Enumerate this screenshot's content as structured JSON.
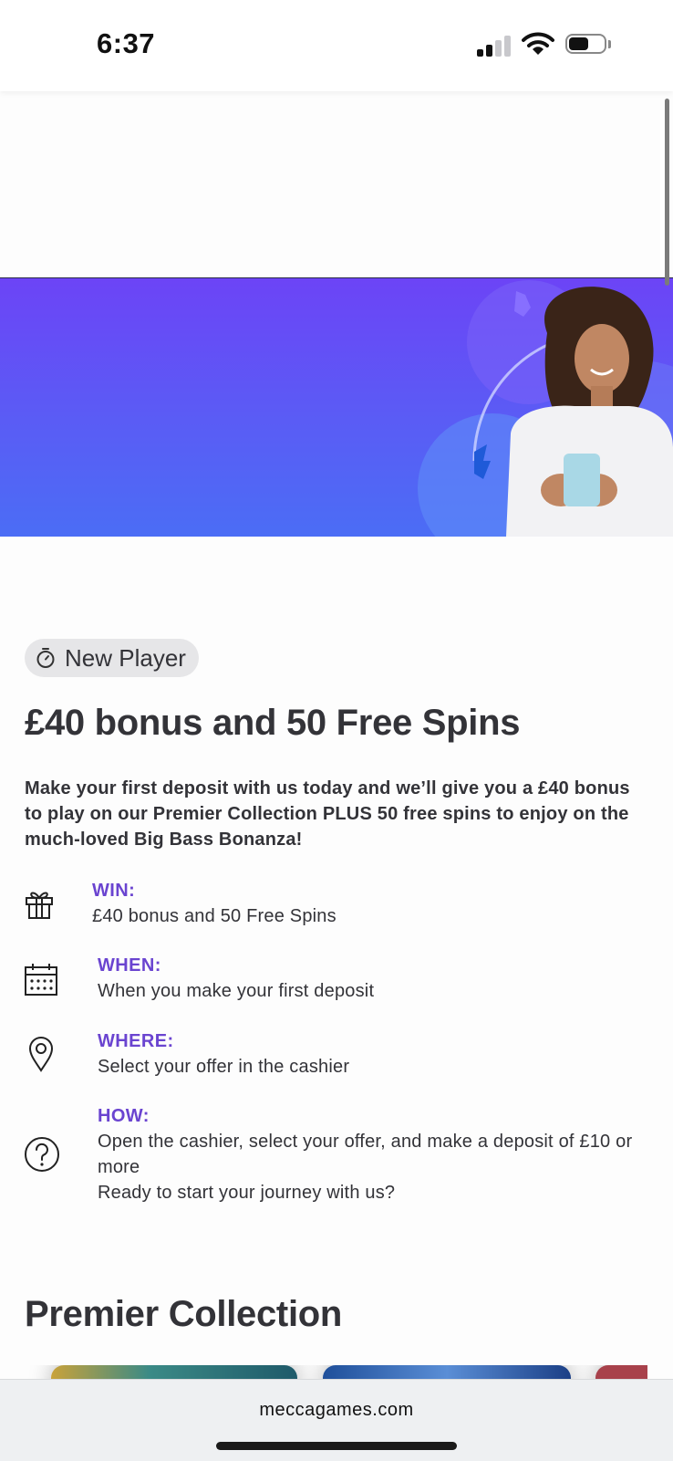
{
  "status_bar": {
    "time": "6:37"
  },
  "banner": {
    "accent_top": "#6c44f6",
    "accent_bottom": "#4b6df5"
  },
  "promo": {
    "badge_label": "New Player",
    "title": "£40 bonus and 50 Free Spins",
    "description": "Make your first deposit with us today and we’ll give you a £40 bonus to play on our Premier Collection PLUS 50 free spins to enjoy on the much-loved Big Bass Bonanza!",
    "details": [
      {
        "icon": "gift-icon",
        "label": "WIN:",
        "lines": [
          "£40 bonus and 50 Free Spins"
        ]
      },
      {
        "icon": "calendar-icon",
        "label": "WHEN:",
        "lines": [
          "When you make your first deposit"
        ]
      },
      {
        "icon": "location-pin-icon",
        "label": "WHERE:",
        "lines": [
          "Select your offer in the cashier"
        ]
      },
      {
        "icon": "question-circle-icon",
        "label": "HOW:",
        "lines": [
          "Open the cashier, select your offer, and make a deposit of £10 or more",
          "Ready to start your journey with us?"
        ]
      }
    ]
  },
  "section": {
    "title": "Premier Collection"
  },
  "browser": {
    "url": "meccagames.com"
  },
  "colors": {
    "label_accent": "#6a44d0",
    "text": "#333338"
  }
}
